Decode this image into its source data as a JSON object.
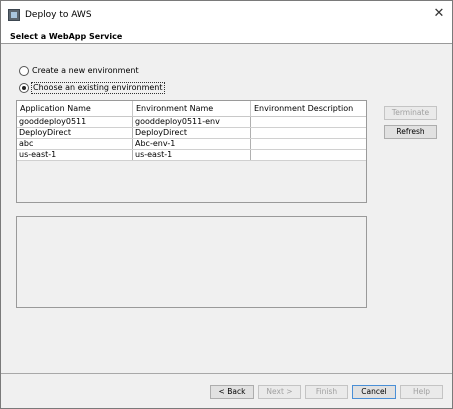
{
  "window": {
    "title": "Deploy to AWS",
    "close_glyph": "✕",
    "icon": "aws-toolkit-app-icon"
  },
  "header": {
    "title": "Select a WebApp Service"
  },
  "options": {
    "create_label": "Create a new environment",
    "existing_label": "Choose an existing environment",
    "selected": "existing"
  },
  "table": {
    "headers": [
      "Application Name",
      "Environment Name",
      "Environment Description"
    ],
    "rows": [
      [
        "gooddeploy0511",
        "gooddeploy0511-env",
        ""
      ],
      [
        "DeployDirect",
        "DeployDirect",
        ""
      ],
      [
        "abc",
        "Abc-env-1",
        ""
      ],
      [
        "us-east-1",
        "us-east-1",
        ""
      ]
    ]
  },
  "side_buttons": {
    "terminate_label": "Terminate",
    "refresh_label": "Refresh"
  },
  "footer": {
    "back_label": "< Back",
    "next_label": "Next >",
    "finish_label": "Finish",
    "cancel_label": "Cancel",
    "help_label": "Help"
  }
}
